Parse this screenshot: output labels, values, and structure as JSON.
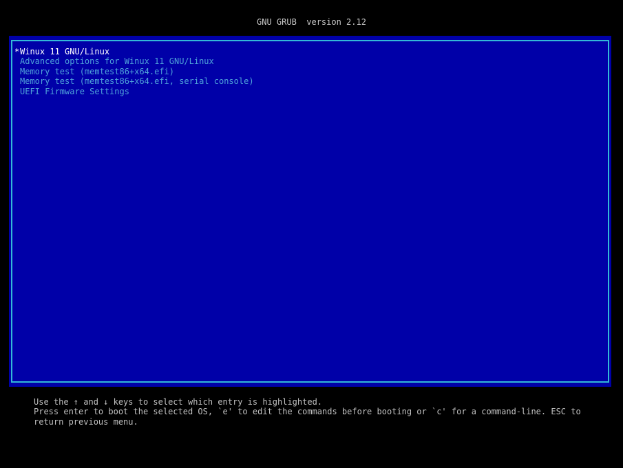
{
  "title": "GNU GRUB  version 2.12",
  "selected_marker": "*",
  "entries": [
    {
      "label": "Winux 11 GNU/Linux",
      "selected": true
    },
    {
      "label": "Advanced options for Winux 11 GNU/Linux",
      "selected": false
    },
    {
      "label": "Memory test (memtest86+x64.efi)",
      "selected": false
    },
    {
      "label": "Memory test (memtest86+x64.efi, serial console)",
      "selected": false
    },
    {
      "label": "UEFI Firmware Settings",
      "selected": false
    }
  ],
  "help": {
    "line1": "Use the ↑ and ↓ keys to select which entry is highlighted.",
    "line2": "Press enter to boot the selected OS, `e' to edit the commands before booting or `c' for a command-line. ESC to",
    "line3": "return previous menu."
  },
  "colors": {
    "background": "#000000",
    "menu_background": "#0000a8",
    "menu_border": "#33b8d8",
    "entry_text": "#4fa3d9",
    "selected_text": "#ffffff",
    "help_text": "#c0c0c0"
  }
}
